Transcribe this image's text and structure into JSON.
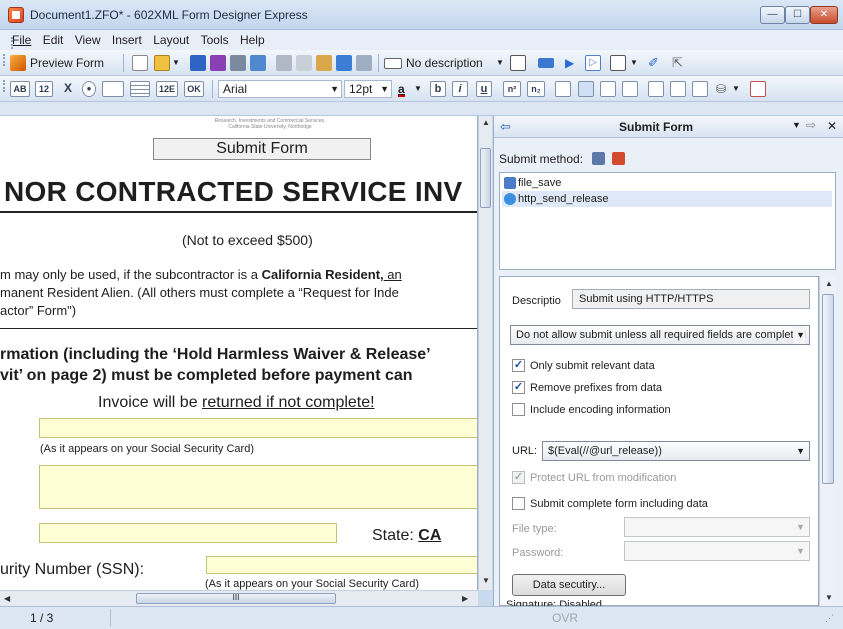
{
  "window": {
    "title": "Document1.ZFO* - 602XML Form Designer Express",
    "min": "—",
    "max": "☐",
    "close": "✕"
  },
  "menu": [
    "File",
    "Edit",
    "View",
    "Insert",
    "Layout",
    "Tools",
    "Help"
  ],
  "toolbar1": {
    "preview_form": "Preview Form",
    "no_description": "No description"
  },
  "toolbar2": {
    "btn_ab": "AB",
    "btn_12": "12",
    "btn_x": "X",
    "btn_12b": "12E",
    "btn_ok": "OK",
    "font": "Arial",
    "size": "12pt",
    "bold": "b",
    "italic": "i",
    "underline": "u",
    "sup": "n²",
    "sub": "n₂"
  },
  "document": {
    "tiny_header": "Research, Investments and Commercial Services, California State University, Northridge",
    "submit_button": "Submit Form",
    "title": "NOR CONTRACTED SERVICE INV",
    "not_exceed": "(Not to exceed $500)",
    "para_line1_a": "m may only be used, if the subcontractor is a ",
    "para_line1_b": "California Resident,",
    "para_line1_c": " an",
    "para_line2": "manent Resident Alien. (All others must complete a “Request for Inde",
    "para_line3": "actor” Form\")",
    "bold_line1": "rmation (including the ‘Hold Harmless Waiver & Release’",
    "bold_line2": "vit’ on page 2) must be completed before payment can",
    "invoice_a": "Invoice will be ",
    "invoice_b": "returned if not complete!",
    "ssn_card_note": "(As it appears on your Social Security Card)",
    "state_label": "State:",
    "state_value": "CA",
    "ssn_label": "urity Number (SSN):",
    "ssn_card_note2": "(As it appears on your Social Security Card)",
    "hscroll_grip": "III"
  },
  "status": {
    "page": "1 / 3",
    "ovr": "OVR"
  },
  "panel": {
    "title": "Submit Form",
    "submit_method_label": "Submit method:",
    "methods": [
      "file_save",
      "http_send_release"
    ],
    "description_label": "Descriptio",
    "description_value": "Submit using HTTP/HTTPS",
    "validation_option": "Do not allow submit unless all required fields are completed",
    "only_relevant": "Only submit relevant data",
    "remove_prefixes": "Remove prefixes from data",
    "include_encoding": "Include encoding information",
    "url_label": "URL:",
    "url_value": "$(Eval(//@url_release))",
    "protect_url": "Protect URL from modification",
    "submit_complete": "Submit complete form including data",
    "file_type_label": "File type:",
    "password_label": "Password:",
    "data_security_button": "Data secutiry...",
    "signature_cut": "Signature: Disabled"
  },
  "colors": {
    "accent": "#1f4aa7",
    "field_yellow": "#fefed5"
  }
}
